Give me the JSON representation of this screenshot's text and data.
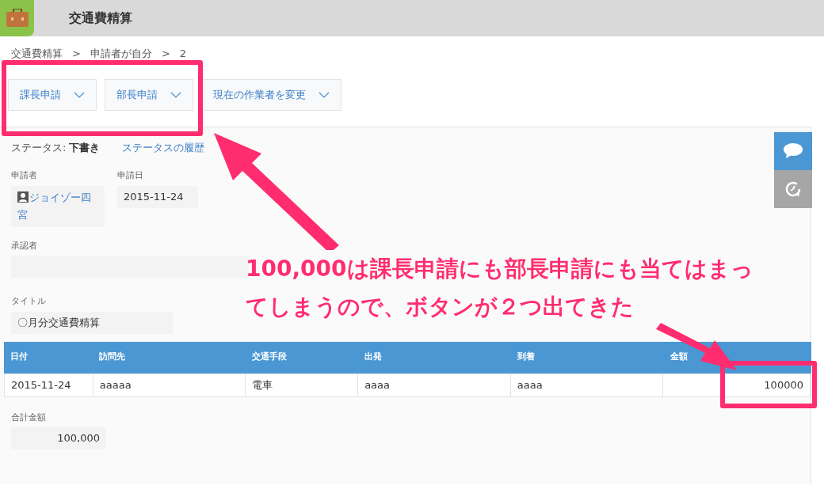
{
  "header": {
    "title": "交通費精算"
  },
  "breadcrumb": [
    "交通費精算",
    ">",
    "申請者が自分",
    ">",
    "2"
  ],
  "action_buttons": [
    "課長申請",
    "部長申請",
    "現在の作業者を変更"
  ],
  "status": {
    "label": "ステータス:",
    "value": "下書き",
    "history_link": "ステータスの履歴"
  },
  "fields": {
    "applicant": {
      "label": "申請者",
      "value": "ジョイゾー四宮"
    },
    "date": {
      "label": "申請日",
      "value": "2015-11-24"
    },
    "approver": {
      "label": "承認者"
    },
    "title": {
      "label": "タイトル",
      "value": "〇月分交通費精算"
    }
  },
  "table": {
    "columns": [
      "日付",
      "訪問先",
      "交通手段",
      "出発",
      "到着",
      "金額"
    ],
    "rows": [
      [
        "2015-11-24",
        "aaaaa",
        "電車",
        "aaaa",
        "aaaa",
        "100000"
      ]
    ]
  },
  "total": {
    "label": "合計金額",
    "value": "100,000"
  },
  "annotation": {
    "lines": [
      "100,000は課長申請にも部長申請にも当てはまっ",
      "てしまうので、ボタンが２つ出てきた"
    ]
  }
}
